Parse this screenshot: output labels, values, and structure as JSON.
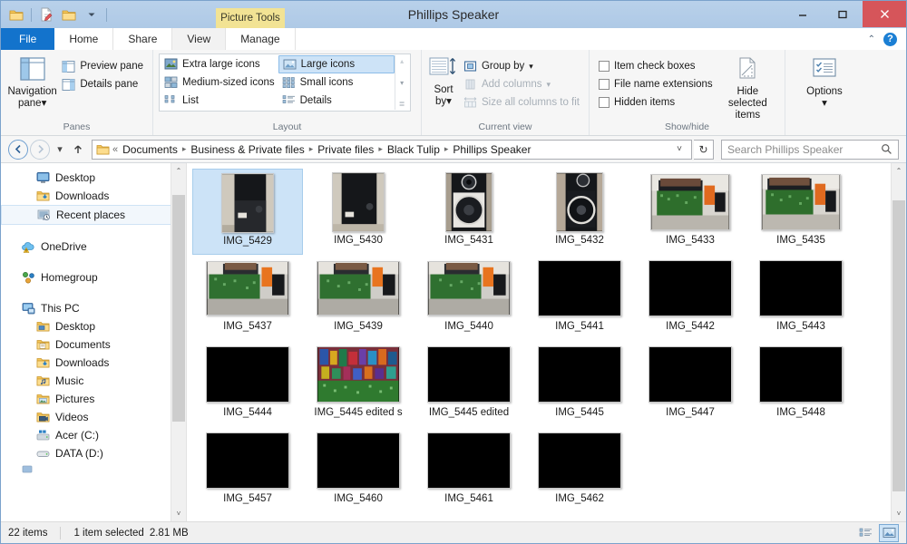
{
  "window": {
    "title": "Phillips Speaker",
    "contextual_tab_label": "Picture Tools",
    "minimize": "–",
    "maximize": "❐",
    "close": "✕"
  },
  "quick_access": {
    "items": [
      {
        "name": "folder-icon",
        "label": "Folder"
      },
      {
        "name": "properties-icon",
        "label": "Properties"
      },
      {
        "name": "new-folder-icon",
        "label": "New folder"
      },
      {
        "name": "customize-dropdown-icon",
        "label": "Customize Quick Access Toolbar"
      }
    ]
  },
  "tabs": [
    {
      "label": "File",
      "key": "file"
    },
    {
      "label": "Home",
      "key": "home"
    },
    {
      "label": "Share",
      "key": "share"
    },
    {
      "label": "View",
      "key": "view"
    },
    {
      "label": "Manage",
      "key": "manage"
    }
  ],
  "tabstrip_right": {
    "collapse_ribbon": "⌃",
    "help": "?"
  },
  "ribbon": {
    "groups": [
      {
        "title": "Panes",
        "big_button": {
          "label_line1": "Navigation",
          "label_line2": "pane",
          "caret": "▾"
        },
        "items": [
          {
            "label": "Preview pane",
            "state": "normal"
          },
          {
            "label": "Details pane",
            "state": "normal"
          }
        ]
      },
      {
        "title": "Layout",
        "left_items": [
          {
            "label": "Extra large icons",
            "state": "normal"
          },
          {
            "label": "Medium-sized icons",
            "state": "normal"
          },
          {
            "label": "List",
            "state": "normal"
          }
        ],
        "right_items": [
          {
            "label": "Large icons",
            "state": "selected"
          },
          {
            "label": "Small icons",
            "state": "normal"
          },
          {
            "label": "Details",
            "state": "normal"
          }
        ],
        "spinner": {
          "up": "▴",
          "down": "▾",
          "more": "≣"
        }
      },
      {
        "title": "Current view",
        "big_button": {
          "label_line1": "Sort",
          "label_line2": "by",
          "caret": "▾"
        },
        "items": [
          {
            "label": "Group by",
            "state": "normal",
            "caret": "▾"
          },
          {
            "label": "Add columns",
            "state": "disabled",
            "caret": "▾"
          },
          {
            "label": "Size all columns to fit",
            "state": "disabled"
          }
        ]
      },
      {
        "title": "Show/hide",
        "checkboxes": [
          {
            "label": "Item check boxes",
            "checked": false
          },
          {
            "label": "File name extensions",
            "checked": false
          },
          {
            "label": "Hidden items",
            "checked": false
          }
        ],
        "big_buttons": [
          {
            "label_line1": "Hide selected",
            "label_line2": "items"
          }
        ]
      },
      {
        "title": "",
        "big_buttons": [
          {
            "label_line1": "Options",
            "label_line2": "",
            "caret": "▾"
          }
        ]
      }
    ]
  },
  "address_bar": {
    "back": "←",
    "forward": "→",
    "recent_dropdown": "▾",
    "up": "↑",
    "folder_icon": "folder-icon",
    "overflow": "«",
    "breadcrumbs": [
      "Documents",
      "Business & Private files",
      "Private files",
      "Black Tulip",
      "Phillips Speaker"
    ],
    "separator": "▸",
    "dropdown_caret": "˅",
    "refresh": "↻",
    "search_placeholder": "Search Phillips Speaker",
    "search_value": "",
    "search_icon": "search-icon"
  },
  "nav_pane": {
    "items": [
      {
        "label": "Desktop",
        "icon": "desktop-icon",
        "indent": 1,
        "selected": false,
        "color": "#3f7fc1"
      },
      {
        "label": "Downloads",
        "icon": "downloads-folder-icon",
        "indent": 1,
        "selected": false,
        "color": "#e8b84b"
      },
      {
        "label": "Recent places",
        "icon": "recent-places-icon",
        "indent": 1,
        "selected": true,
        "color": "#8aa0b8"
      },
      {
        "label": "",
        "icon": "spacer",
        "indent": 0,
        "selected": false,
        "spacer": true
      },
      {
        "label": "OneDrive",
        "icon": "onedrive-icon",
        "indent": 0,
        "selected": false,
        "color": "#5fb4e8"
      },
      {
        "label": "",
        "icon": "spacer",
        "indent": 0,
        "selected": false,
        "spacer": true
      },
      {
        "label": "Homegroup",
        "icon": "homegroup-icon",
        "indent": 0,
        "selected": false,
        "color": "#4aa84a"
      },
      {
        "label": "",
        "icon": "spacer",
        "indent": 0,
        "selected": false,
        "spacer": true
      },
      {
        "label": "This PC",
        "icon": "this-pc-icon",
        "indent": 0,
        "selected": false,
        "color": "#4a8fd0"
      },
      {
        "label": "Desktop",
        "icon": "desktop-folder-icon",
        "indent": 1,
        "selected": false,
        "color": "#e8c05a"
      },
      {
        "label": "Documents",
        "icon": "documents-folder-icon",
        "indent": 1,
        "selected": false,
        "color": "#e8c05a"
      },
      {
        "label": "Downloads",
        "icon": "downloads-folder-icon",
        "indent": 1,
        "selected": false,
        "color": "#e8c05a"
      },
      {
        "label": "Music",
        "icon": "music-folder-icon",
        "indent": 1,
        "selected": false,
        "color": "#e8c05a"
      },
      {
        "label": "Pictures",
        "icon": "pictures-folder-icon",
        "indent": 1,
        "selected": false,
        "color": "#e8c05a"
      },
      {
        "label": "Videos",
        "icon": "videos-folder-icon",
        "indent": 1,
        "selected": false,
        "color": "#e8c05a"
      },
      {
        "label": "Acer (C:)",
        "icon": "local-disk-icon",
        "indent": 1,
        "selected": false,
        "color": "#7fb5e0"
      },
      {
        "label": "DATA (D:)",
        "icon": "local-disk-icon",
        "indent": 1,
        "selected": false,
        "color": "#c9c9c9"
      }
    ],
    "scrollbar": {
      "up": "⌃",
      "down": "˅"
    }
  },
  "files": [
    {
      "name": "IMG_5429",
      "selected": true,
      "kind": "speaker-dark"
    },
    {
      "name": "IMG_5430",
      "selected": false,
      "kind": "speaker-dark"
    },
    {
      "name": "IMG_5431",
      "selected": false,
      "kind": "speaker-cone"
    },
    {
      "name": "IMG_5432",
      "selected": false,
      "kind": "speaker-cone"
    },
    {
      "name": "IMG_5433",
      "selected": false,
      "kind": "circuit-board"
    },
    {
      "name": "IMG_5435",
      "selected": false,
      "kind": "circuit-board"
    },
    {
      "name": "IMG_5437",
      "selected": false,
      "kind": "circuit-board"
    },
    {
      "name": "IMG_5439",
      "selected": false,
      "kind": "circuit-board"
    },
    {
      "name": "IMG_5440",
      "selected": false,
      "kind": "circuit-board"
    },
    {
      "name": "IMG_5441",
      "selected": false,
      "kind": "black"
    },
    {
      "name": "IMG_5442",
      "selected": false,
      "kind": "black"
    },
    {
      "name": "IMG_5443",
      "selected": false,
      "kind": "black"
    },
    {
      "name": "IMG_5444",
      "selected": false,
      "kind": "black"
    },
    {
      "name": "IMG_5445 edited s",
      "selected": false,
      "kind": "colorful"
    },
    {
      "name": "IMG_5445 edited",
      "selected": false,
      "kind": "black"
    },
    {
      "name": "IMG_5445",
      "selected": false,
      "kind": "black"
    },
    {
      "name": "IMG_5447",
      "selected": false,
      "kind": "black"
    },
    {
      "name": "IMG_5448",
      "selected": false,
      "kind": "black"
    },
    {
      "name": "IMG_5457",
      "selected": false,
      "kind": "black"
    },
    {
      "name": "IMG_5460",
      "selected": false,
      "kind": "black"
    },
    {
      "name": "IMG_5461",
      "selected": false,
      "kind": "black"
    },
    {
      "name": "IMG_5462",
      "selected": false,
      "kind": "black"
    }
  ],
  "file_pane": {
    "scrollbar": {
      "up": "⌃",
      "down": "˅"
    }
  },
  "status_bar": {
    "item_count": "22 items",
    "selection": "1 item selected",
    "selection_size": "2.81 MB",
    "view_details_icon": "details-view-icon",
    "view_thumbnails_icon": "large-icons-view-icon"
  },
  "colors": {
    "accent": "#1373cc",
    "selection": "#cce3f7",
    "contextual_tab": "#f2e394",
    "close_button": "#d6555a"
  }
}
